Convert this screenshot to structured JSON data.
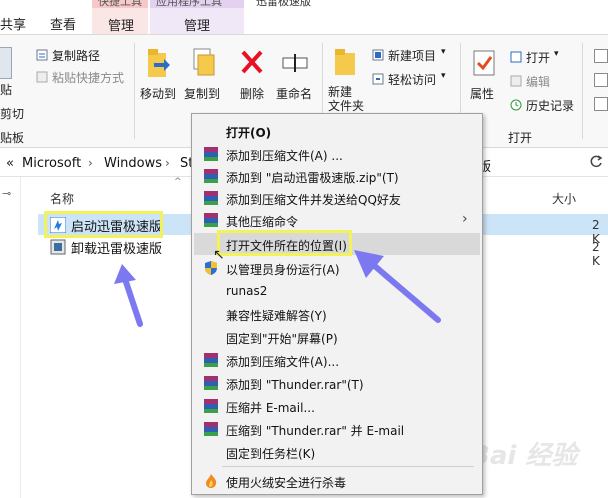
{
  "window": {
    "title": "迅雷极速版"
  },
  "tabs": {
    "share": "共享",
    "view": "查看",
    "manage1": "管理",
    "manage2": "管理"
  },
  "context_tabs": {
    "shortcut_tools": "快捷工具",
    "app_tools": "应用程序工具"
  },
  "ribbon": {
    "paste": "贴",
    "copy_path": "复制路径",
    "paste_shortcut": "粘贴快捷方式",
    "cut": "剪切",
    "clipboard": "贴板",
    "move_to": "移动到",
    "copy_to": "复制到",
    "delete": "删除",
    "rename": "重命名",
    "new_folder": "新建\n文件夹",
    "new_item": "新建项目",
    "easy_access": "轻松访问",
    "properties": "属性",
    "open": "打开",
    "edit": "编辑",
    "history": "历史记录",
    "open_group": "打开"
  },
  "address": {
    "back": "«",
    "crumbs": [
      "Microsoft",
      "Windows",
      "St"
    ],
    "tail": "版"
  },
  "list": {
    "col_name": "名称",
    "col_size": "大小",
    "items": [
      {
        "label": "启动迅雷极速版",
        "size": "2 K"
      },
      {
        "label": "卸载迅雷极速版",
        "size": "2 K"
      }
    ]
  },
  "context_menu": {
    "items": [
      {
        "label": "打开(O)"
      },
      {
        "label": "添加到压缩文件(A) ..."
      },
      {
        "label": "添加到 \"启动迅雷极速版.zip\"(T)"
      },
      {
        "label": "添加到压缩文件并发送给QQ好友"
      },
      {
        "label": "其他压缩命令"
      },
      {
        "label": "打开文件所在的位置(I)"
      },
      {
        "label": "以管理员身份运行(A)"
      },
      {
        "label": "runas2"
      },
      {
        "label": "兼容性疑难解答(Y)"
      },
      {
        "label": "固定到\"开始\"屏幕(P)"
      },
      {
        "label": "添加到压缩文件(A)..."
      },
      {
        "label": "添加到 \"Thunder.rar\"(T)"
      },
      {
        "label": "压缩并 E-mail..."
      },
      {
        "label": "压缩到 \"Thunder.rar\" 并 E-mail"
      },
      {
        "label": "固定到任务栏(K)"
      },
      {
        "label": "使用火绒安全进行杀毒"
      }
    ]
  },
  "watermark": "Bai 经验",
  "colors": {
    "accent": "#0078d7",
    "highlight_yellow": "#f4f25a",
    "arrow": "#7b78f0",
    "delete_red": "#e81123"
  }
}
